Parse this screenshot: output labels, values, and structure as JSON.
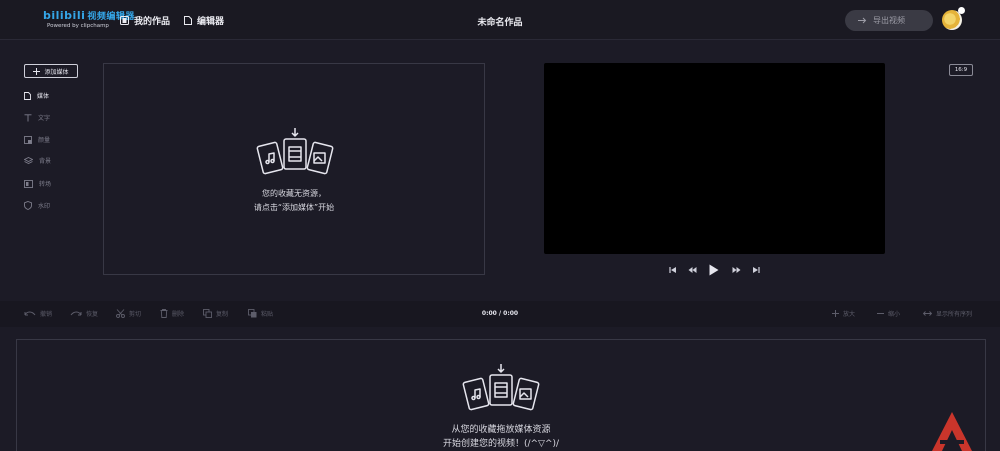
{
  "header": {
    "logo_main": "bilibili",
    "logo_sub": "视频编辑器",
    "logo_powered": "Powered by clipchamp",
    "nav_works": "我的作品",
    "nav_editor": "编辑器",
    "project_title": "未命名作品",
    "export_label": "导出视频"
  },
  "sidebar": {
    "add_media": "添加媒体",
    "items": [
      {
        "label": "媒体",
        "icon": "document-icon"
      },
      {
        "label": "文字",
        "icon": "text-icon"
      },
      {
        "label": "颜量",
        "icon": "color-icon"
      },
      {
        "label": "背景",
        "icon": "layers-icon"
      },
      {
        "label": "转场",
        "icon": "transition-icon"
      },
      {
        "label": "水印",
        "icon": "shield-icon"
      }
    ]
  },
  "media_panel": {
    "empty_line1": "您的收藏无资源，",
    "empty_line2": "请点击“添加媒体”开始"
  },
  "preview": {
    "ratio": "16:9"
  },
  "toolbar": {
    "undo": "撤销",
    "redo": "恢复",
    "split": "剪切",
    "delete": "删除",
    "copy": "复制",
    "paste": "粘贴",
    "timecode": "0:00 / 0:00",
    "zoom_in": "放大",
    "zoom_out": "缩小",
    "fit_all": "显示所有序列"
  },
  "timeline": {
    "empty_line1": "从您的收藏拖放媒体资源",
    "empty_line2": "开始创建您的视频！(/^▽^)/"
  },
  "colors": {
    "background": "#1c1b26",
    "header": "#1a1922",
    "accent": "#35a6e8",
    "preview": "#000000",
    "corner_logo": "#c9352b"
  }
}
